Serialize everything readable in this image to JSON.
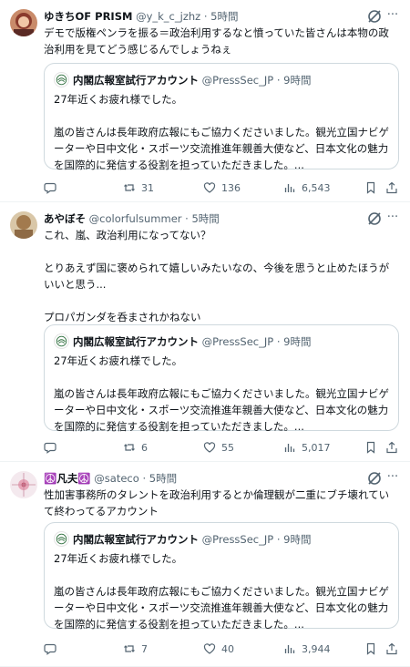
{
  "tweets": [
    {
      "name": "ゆきちOF PRISM",
      "handle": "@y_k_c_jzhz",
      "dot": "·",
      "time": "5時間",
      "text": "デモで版権ペンラを振る＝政治利用するなと憤っていた皆さんは本物の政治利用を見てどう感じるんでしょうねぇ",
      "quote": {
        "name": "内閣広報室試行アカウント",
        "handle": "@PressSec_JP",
        "dot": "·",
        "time": "9時間",
        "text": "27年近くお疲れ様でした。\n\n嵐の皆さんは長年政府広報にもご協力くださいました。観光立国ナビゲーターや日中文化・スポーツ交流推進年親善大使など、日本文化の魅力を国際的に発信する役割を担っていただきました。..."
      },
      "stats": {
        "replies": "",
        "reposts": "31",
        "likes": "136",
        "views": "6,543"
      }
    },
    {
      "name": "あやぼそ",
      "handle": "@colorfulsummer",
      "dot": "·",
      "time": "5時間",
      "text": "これ、嵐、政治利用になってない？\n\nとりあえず国に褒められて嬉しいみたいなの、今後を思うと止めたほうがいいと思う...\n\nプロパガンダを呑まされかねない",
      "quote": {
        "name": "内閣広報室試行アカウント",
        "handle": "@PressSec_JP",
        "dot": "·",
        "time": "9時間",
        "text": "27年近くお疲れ様でした。\n\n嵐の皆さんは長年政府広報にもご協力くださいました。観光立国ナビゲーターや日中文化・スポーツ交流推進年親善大使など、日本文化の魅力を国際的に発信する役割を担っていただきました。..."
      },
      "stats": {
        "replies": "",
        "reposts": "6",
        "likes": "55",
        "views": "5,017"
      }
    },
    {
      "name": "☮️凡夫☮️",
      "handle": "@sateco",
      "dot": "·",
      "time": "5時間",
      "text": "性加害事務所のタレントを政治利用するとか倫理観が二重にブチ壊れていて終わってるアカウント",
      "quote": {
        "name": "内閣広報室試行アカウント",
        "handle": "@PressSec_JP",
        "dot": "·",
        "time": "9時間",
        "text": "27年近くお疲れ様でした。\n\n嵐の皆さんは長年政府広報にもご協力くださいました。観光立国ナビゲーターや日中文化・スポーツ交流推進年親善大使など、日本文化の魅力を国際的に発信する役割を担っていただきました。..."
      },
      "stats": {
        "replies": "",
        "reposts": "7",
        "likes": "40",
        "views": "3,944"
      }
    }
  ],
  "icons": {
    "grok": "grok-icon",
    "more": "more-icon",
    "reply": "reply-icon",
    "repost": "repost-icon",
    "like": "like-icon",
    "views": "views-icon",
    "bookmark": "bookmark-icon",
    "share": "share-icon"
  },
  "more_glyph": "···",
  "colors": {
    "text": "#0f1419",
    "muted": "#536471",
    "border": "#cfd9de",
    "divider": "#eff3f4"
  }
}
